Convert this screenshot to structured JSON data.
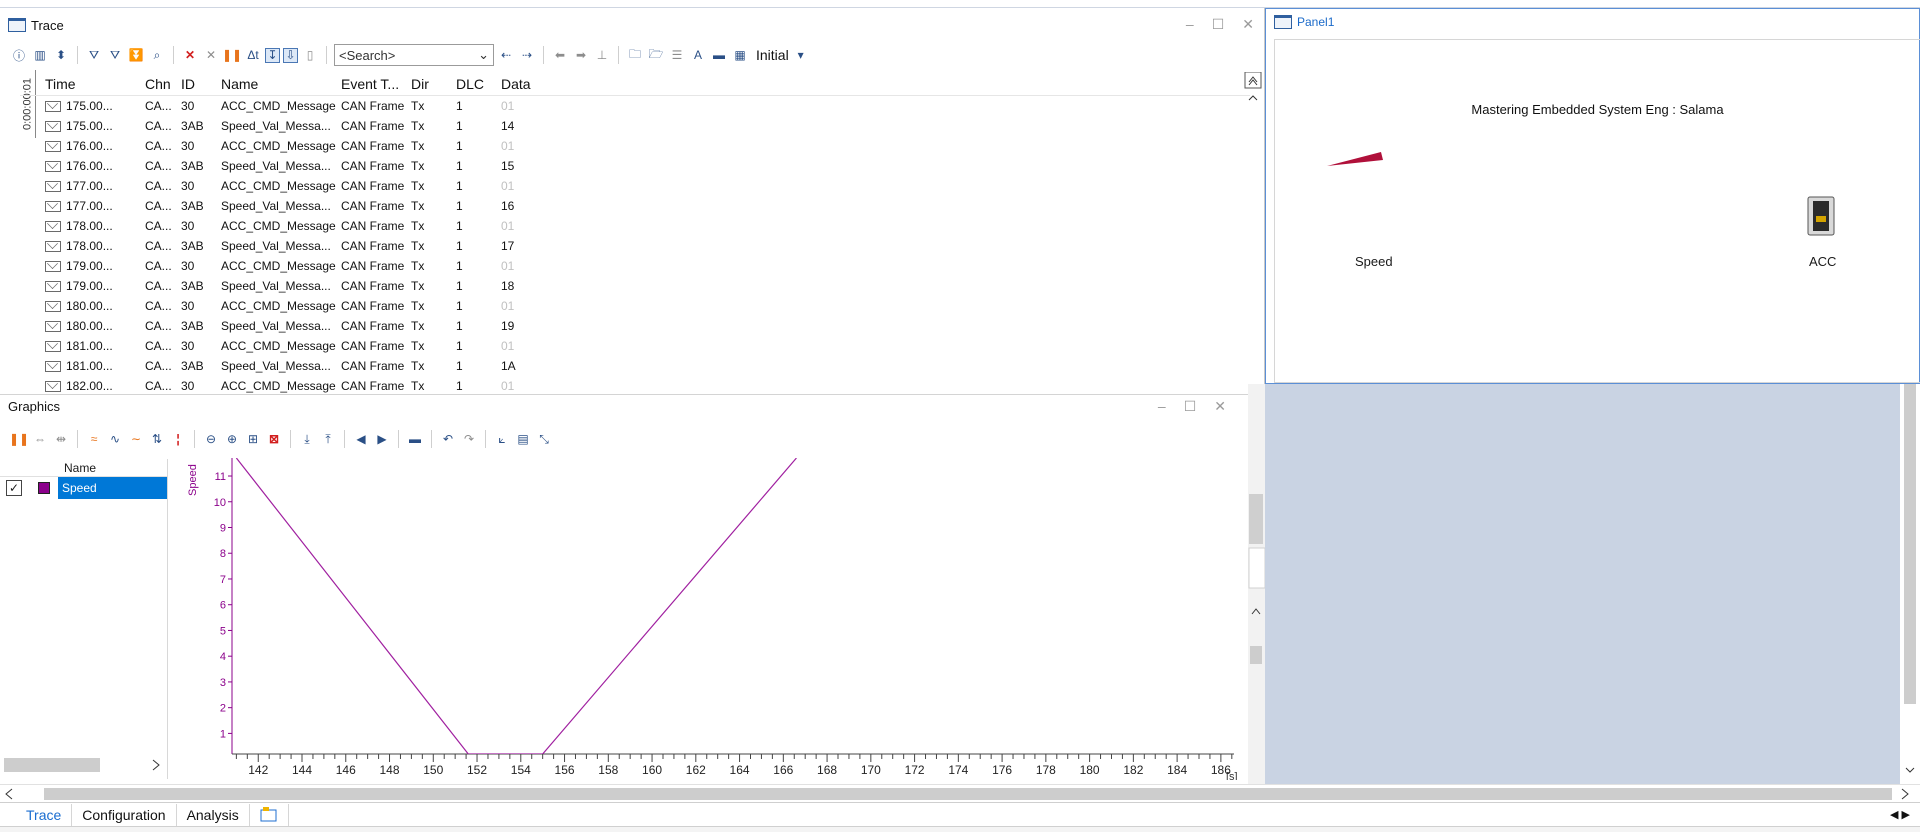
{
  "trace": {
    "title": "Trace",
    "search_placeholder": "<Search>",
    "config_label": "Initial",
    "time_strip": "0:00:00:01",
    "columns": [
      "Time",
      "Chn",
      "ID",
      "Name",
      "Event T...",
      "Dir",
      "DLC",
      "Data"
    ],
    "rows": [
      {
        "time": "175.00...",
        "chn": "CA...",
        "id": "30",
        "name": "ACC_CMD_Message",
        "evt": "CAN Frame",
        "dir": "Tx",
        "dlc": "1",
        "data": "01"
      },
      {
        "time": "175.00...",
        "chn": "CA...",
        "id": "3AB",
        "name": "Speed_Val_Messa...",
        "evt": "CAN Frame",
        "dir": "Tx",
        "dlc": "1",
        "data": "14"
      },
      {
        "time": "176.00...",
        "chn": "CA...",
        "id": "30",
        "name": "ACC_CMD_Message",
        "evt": "CAN Frame",
        "dir": "Tx",
        "dlc": "1",
        "data": "01"
      },
      {
        "time": "176.00...",
        "chn": "CA...",
        "id": "3AB",
        "name": "Speed_Val_Messa...",
        "evt": "CAN Frame",
        "dir": "Tx",
        "dlc": "1",
        "data": "15"
      },
      {
        "time": "177.00...",
        "chn": "CA...",
        "id": "30",
        "name": "ACC_CMD_Message",
        "evt": "CAN Frame",
        "dir": "Tx",
        "dlc": "1",
        "data": "01"
      },
      {
        "time": "177.00...",
        "chn": "CA...",
        "id": "3AB",
        "name": "Speed_Val_Messa...",
        "evt": "CAN Frame",
        "dir": "Tx",
        "dlc": "1",
        "data": "16"
      },
      {
        "time": "178.00...",
        "chn": "CA...",
        "id": "30",
        "name": "ACC_CMD_Message",
        "evt": "CAN Frame",
        "dir": "Tx",
        "dlc": "1",
        "data": "01"
      },
      {
        "time": "178.00...",
        "chn": "CA...",
        "id": "3AB",
        "name": "Speed_Val_Messa...",
        "evt": "CAN Frame",
        "dir": "Tx",
        "dlc": "1",
        "data": "17"
      },
      {
        "time": "179.00...",
        "chn": "CA...",
        "id": "30",
        "name": "ACC_CMD_Message",
        "evt": "CAN Frame",
        "dir": "Tx",
        "dlc": "1",
        "data": "01"
      },
      {
        "time": "179.00...",
        "chn": "CA...",
        "id": "3AB",
        "name": "Speed_Val_Messa...",
        "evt": "CAN Frame",
        "dir": "Tx",
        "dlc": "1",
        "data": "18"
      },
      {
        "time": "180.00...",
        "chn": "CA...",
        "id": "30",
        "name": "ACC_CMD_Message",
        "evt": "CAN Frame",
        "dir": "Tx",
        "dlc": "1",
        "data": "01"
      },
      {
        "time": "180.00...",
        "chn": "CA...",
        "id": "3AB",
        "name": "Speed_Val_Messa...",
        "evt": "CAN Frame",
        "dir": "Tx",
        "dlc": "1",
        "data": "19"
      },
      {
        "time": "181.00...",
        "chn": "CA...",
        "id": "30",
        "name": "ACC_CMD_Message",
        "evt": "CAN Frame",
        "dir": "Tx",
        "dlc": "1",
        "data": "01"
      },
      {
        "time": "181.00...",
        "chn": "CA...",
        "id": "3AB",
        "name": "Speed_Val_Messa...",
        "evt": "CAN Frame",
        "dir": "Tx",
        "dlc": "1",
        "data": "1A"
      },
      {
        "time": "182.00...",
        "chn": "CA...",
        "id": "30",
        "name": "ACC_CMD_Message",
        "evt": "CAN Frame",
        "dir": "Tx",
        "dlc": "1",
        "data": "01"
      }
    ]
  },
  "graphics": {
    "title": "Graphics",
    "signal_list_header": "Name",
    "signal": {
      "name": "Speed",
      "color": "#8b008b",
      "checked": true
    }
  },
  "panel": {
    "title": "Panel1",
    "caption": "Mastering Embedded System  Eng : Salama",
    "speed_label": "Speed",
    "acc_label": "ACC",
    "needle_color": "#b0103a"
  },
  "tabs": [
    {
      "label": "Trace",
      "active": true
    },
    {
      "label": "Configuration",
      "active": false
    },
    {
      "label": "Analysis",
      "active": false
    }
  ],
  "chart_data": {
    "type": "line",
    "ylabel": "Speed",
    "xlabel": "",
    "x_unit": "[s]",
    "xlim": [
      140.8,
      186.6
    ],
    "ylim": [
      0.2,
      11.7
    ],
    "xticks": [
      142,
      144,
      146,
      148,
      150,
      152,
      154,
      156,
      158,
      160,
      162,
      164,
      166,
      168,
      170,
      172,
      174,
      176,
      178,
      180,
      182,
      184,
      186
    ],
    "yticks": [
      1,
      2,
      3,
      4,
      5,
      6,
      7,
      8,
      9,
      10,
      11
    ],
    "series": [
      {
        "name": "Speed",
        "color": "#a020a0",
        "x": [
          141.0,
          151.6,
          155.0,
          166.6
        ],
        "y": [
          11.7,
          0.2,
          0.2,
          11.7
        ]
      }
    ]
  }
}
